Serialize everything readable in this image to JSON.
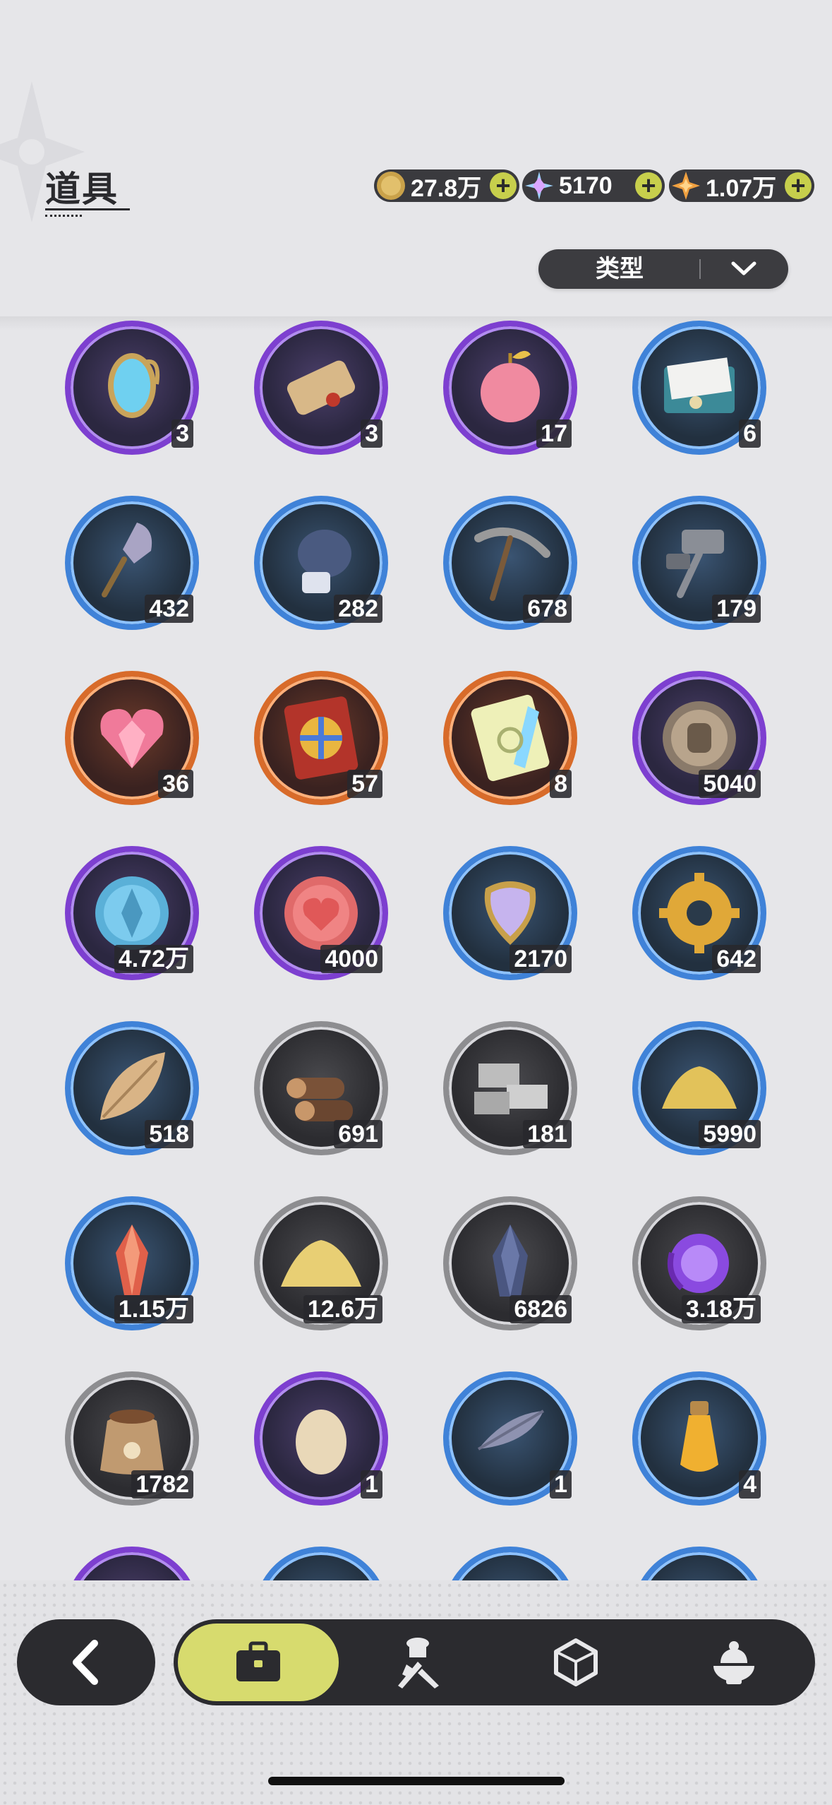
{
  "header": {
    "title": "道具"
  },
  "currencies": [
    {
      "icon": "gold-coin-icon",
      "value": "27.8万"
    },
    {
      "icon": "crystal-snowflake-icon",
      "value": "5170"
    },
    {
      "icon": "orange-star-gem-icon",
      "value": "1.07万"
    }
  ],
  "filter": {
    "label": "类型"
  },
  "items": [
    {
      "icon": "mirror-icon",
      "count": "3",
      "rarity": "purple"
    },
    {
      "icon": "scroll-icon",
      "count": "3",
      "rarity": "purple"
    },
    {
      "icon": "apple-icon",
      "count": "17",
      "rarity": "purple"
    },
    {
      "icon": "envelope-icon",
      "count": "6",
      "rarity": "blue"
    },
    {
      "icon": "shovel-icon",
      "count": "432",
      "rarity": "blue"
    },
    {
      "icon": "boxing-glove-icon",
      "count": "282",
      "rarity": "blue"
    },
    {
      "icon": "pickaxe-icon",
      "count": "678",
      "rarity": "blue"
    },
    {
      "icon": "hammer-icon",
      "count": "179",
      "rarity": "blue"
    },
    {
      "icon": "crystal-heart-icon",
      "count": "36",
      "rarity": "orange"
    },
    {
      "icon": "wheel-ticket-icon",
      "count": "57",
      "rarity": "orange"
    },
    {
      "icon": "rainbow-ticket-icon",
      "count": "8",
      "rarity": "orange"
    },
    {
      "icon": "fist-coin-icon",
      "count": "5040",
      "rarity": "purple"
    },
    {
      "icon": "blue-coin-icon",
      "count": "4.72万",
      "rarity": "purple"
    },
    {
      "icon": "heart-coin-icon",
      "count": "4000",
      "rarity": "purple"
    },
    {
      "icon": "scale-pendant-icon",
      "count": "2170",
      "rarity": "blue"
    },
    {
      "icon": "gear-icon",
      "count": "642",
      "rarity": "blue"
    },
    {
      "icon": "leaf-icon",
      "count": "518",
      "rarity": "blue"
    },
    {
      "icon": "wood-logs-icon",
      "count": "691",
      "rarity": "gray"
    },
    {
      "icon": "stone-bricks-icon",
      "count": "181",
      "rarity": "gray"
    },
    {
      "icon": "gold-sand-icon",
      "count": "5990",
      "rarity": "blue"
    },
    {
      "icon": "red-crystal-icon",
      "count": "1.15万",
      "rarity": "blue"
    },
    {
      "icon": "sand-pile-icon",
      "count": "12.6万",
      "rarity": "gray"
    },
    {
      "icon": "dark-crystal-icon",
      "count": "6826",
      "rarity": "gray"
    },
    {
      "icon": "purple-orb-icon",
      "count": "3.18万",
      "rarity": "gray"
    },
    {
      "icon": "seed-bag-icon",
      "count": "1782",
      "rarity": "gray"
    },
    {
      "icon": "egg-icon",
      "count": "1",
      "rarity": "purple"
    },
    {
      "icon": "feather-bundle-icon",
      "count": "1",
      "rarity": "blue"
    },
    {
      "icon": "potion-vial-icon",
      "count": "4",
      "rarity": "blue"
    }
  ],
  "bottom_nav": {
    "back": "back-arrow-icon",
    "tabs": [
      {
        "icon": "briefcase-icon",
        "active": true
      },
      {
        "icon": "chef-hat-icon",
        "active": false
      },
      {
        "icon": "hexagon-gem-icon",
        "active": false
      },
      {
        "icon": "dessert-bowl-icon",
        "active": false
      }
    ]
  },
  "colors": {
    "background": "#e6e6e9",
    "accent": "#d7db6e",
    "purple": "#7d3fd0",
    "blue": "#3f82d8",
    "orange": "#d86b2a",
    "gray": "#8d8d90"
  }
}
